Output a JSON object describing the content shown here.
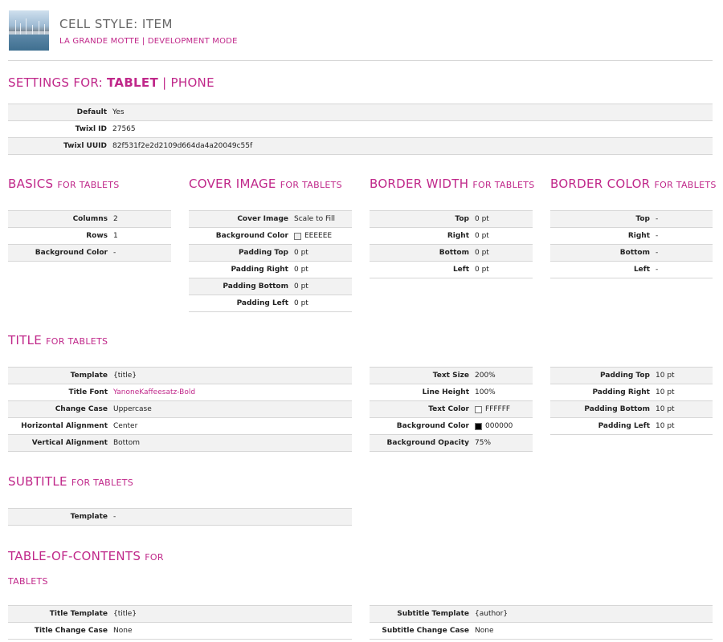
{
  "header": {
    "title": "CELL STYLE: ITEM",
    "project": "LA GRANDE MOTTE",
    "separator": "|",
    "mode": "DEVELOPMENT MODE"
  },
  "settings": {
    "prefix": "SETTINGS FOR:",
    "active_device": "TABLET",
    "separator": "|",
    "other_device": "PHONE",
    "rows": [
      {
        "label": "Default",
        "value": "Yes"
      },
      {
        "label": "Twixl ID",
        "value": "27565"
      },
      {
        "label": "Twixl UUID",
        "value": "82f531f2e2d2109d664da4a20049c55f"
      }
    ]
  },
  "basics": {
    "title": "BASICS",
    "subtitle": "FOR TABLETS",
    "rows": [
      {
        "label": "Columns",
        "value": "2"
      },
      {
        "label": "Rows",
        "value": "1"
      },
      {
        "label": "Background Color",
        "value": "-"
      }
    ]
  },
  "cover_image": {
    "title": "COVER IMAGE",
    "subtitle": "FOR TABLETS",
    "rows": [
      {
        "label": "Cover Image",
        "value": "Scale to Fill"
      },
      {
        "label": "Background Color",
        "value": "EEEEEE",
        "swatch": "#eeeeee"
      },
      {
        "label": "Padding Top",
        "value": "0 pt"
      },
      {
        "label": "Padding Right",
        "value": "0 pt"
      },
      {
        "label": "Padding Bottom",
        "value": "0 pt"
      },
      {
        "label": "Padding Left",
        "value": "0 pt"
      }
    ]
  },
  "border_width": {
    "title": "BORDER WIDTH",
    "subtitle": "FOR TABLETS",
    "rows": [
      {
        "label": "Top",
        "value": "0 pt"
      },
      {
        "label": "Right",
        "value": "0 pt"
      },
      {
        "label": "Bottom",
        "value": "0 pt"
      },
      {
        "label": "Left",
        "value": "0 pt"
      }
    ]
  },
  "border_color": {
    "title": "BORDER COLOR",
    "subtitle": "FOR TABLETS",
    "rows": [
      {
        "label": "Top",
        "value": "-"
      },
      {
        "label": "Right",
        "value": "-"
      },
      {
        "label": "Bottom",
        "value": "-"
      },
      {
        "label": "Left",
        "value": "-"
      }
    ]
  },
  "title_section": {
    "title": "TITLE",
    "subtitle": "FOR TABLETS",
    "text_rows": [
      {
        "label": "Template",
        "value": "{title}"
      },
      {
        "label": "Title Font",
        "value": "YanoneKaffeesatz-Bold"
      },
      {
        "label": "Change Case",
        "value": "Uppercase"
      },
      {
        "label": "Horizontal Alignment",
        "value": "Center"
      },
      {
        "label": "Vertical Alignment",
        "value": "Bottom"
      }
    ],
    "style_rows": [
      {
        "label": "Text Size",
        "value": "200%"
      },
      {
        "label": "Line Height",
        "value": "100%"
      },
      {
        "label": "Text Color",
        "value": "FFFFFF",
        "swatch": "#ffffff"
      },
      {
        "label": "Background Color",
        "value": "000000",
        "swatch": "#000000"
      },
      {
        "label": "Background Opacity",
        "value": "75%"
      }
    ],
    "padding_rows": [
      {
        "label": "Padding Top",
        "value": "10 pt"
      },
      {
        "label": "Padding Right",
        "value": "10 pt"
      },
      {
        "label": "Padding Bottom",
        "value": "10 pt"
      },
      {
        "label": "Padding Left",
        "value": "10 pt"
      }
    ]
  },
  "subtitle_section": {
    "title": "SUBTITLE",
    "subtitle": "FOR TABLETS",
    "rows": [
      {
        "label": "Template",
        "value": "-"
      }
    ]
  },
  "toc": {
    "title": "TABLE-OF-CONTENTS",
    "subtitle_1": "FOR",
    "subtitle_2": "TABLETS",
    "left_rows": [
      {
        "label": "Title Template",
        "value": "{title}"
      },
      {
        "label": "Title Change Case",
        "value": "None"
      }
    ],
    "right_rows": [
      {
        "label": "Subtitle Template",
        "value": "{author}"
      },
      {
        "label": "Subtitle Change Case",
        "value": "None"
      }
    ]
  },
  "colors": {
    "accent": "#c0288a",
    "row_stripe": "#f2f2f2",
    "rule": "#d6d6d6"
  }
}
